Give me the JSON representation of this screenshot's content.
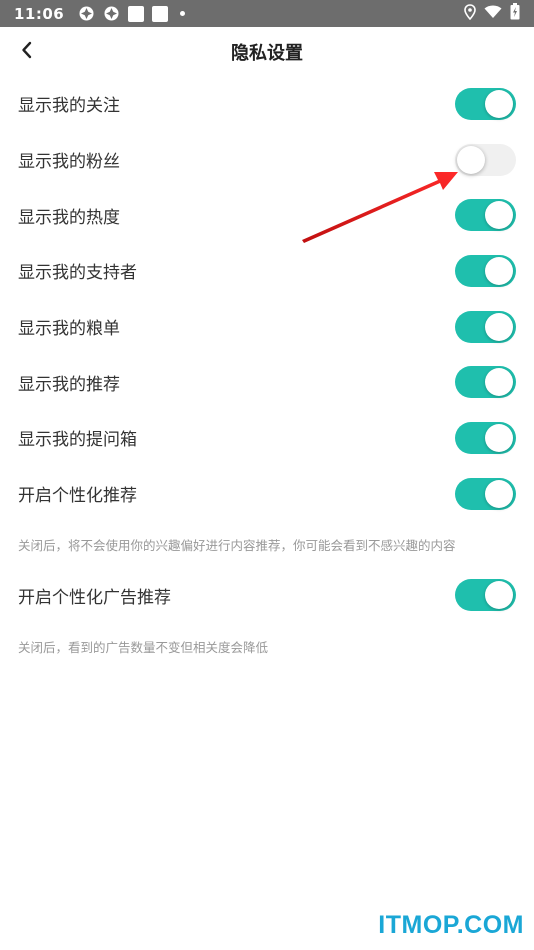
{
  "status_bar": {
    "time": "11:06",
    "icons": [
      "app-notification-icon",
      "app-notification-icon",
      "square-notification-icon",
      "square-notification-icon",
      "more-dot-icon",
      "location-icon",
      "wifi-icon",
      "battery-charging-icon"
    ]
  },
  "header": {
    "title": "隐私设置",
    "back_icon": "chevron-left-icon"
  },
  "settings": {
    "items": [
      {
        "label": "显示我的关注",
        "enabled": true
      },
      {
        "label": "显示我的粉丝",
        "enabled": false
      },
      {
        "label": "显示我的热度",
        "enabled": true
      },
      {
        "label": "显示我的支持者",
        "enabled": true
      },
      {
        "label": "显示我的粮单",
        "enabled": true
      },
      {
        "label": "显示我的推荐",
        "enabled": true
      },
      {
        "label": "显示我的提问箱",
        "enabled": true
      },
      {
        "label": "开启个性化推荐",
        "enabled": true
      }
    ],
    "personalized_hint": "关闭后，将不会使用你的兴趣偏好进行内容推荐，你可能会看到不感兴趣的内容",
    "ad_item": {
      "label": "开启个性化广告推荐",
      "enabled": true
    },
    "ad_hint": "关闭后，看到的广告数量不变但相关度会降低"
  },
  "colors": {
    "toggle_on": "#1fbfad",
    "toggle_off": "#f0f0f0",
    "status_bar": "#6d6d6d",
    "annotation_arrow": "#e02020",
    "watermark": "#1aa7d6"
  },
  "watermark": "ITMOP.COM"
}
